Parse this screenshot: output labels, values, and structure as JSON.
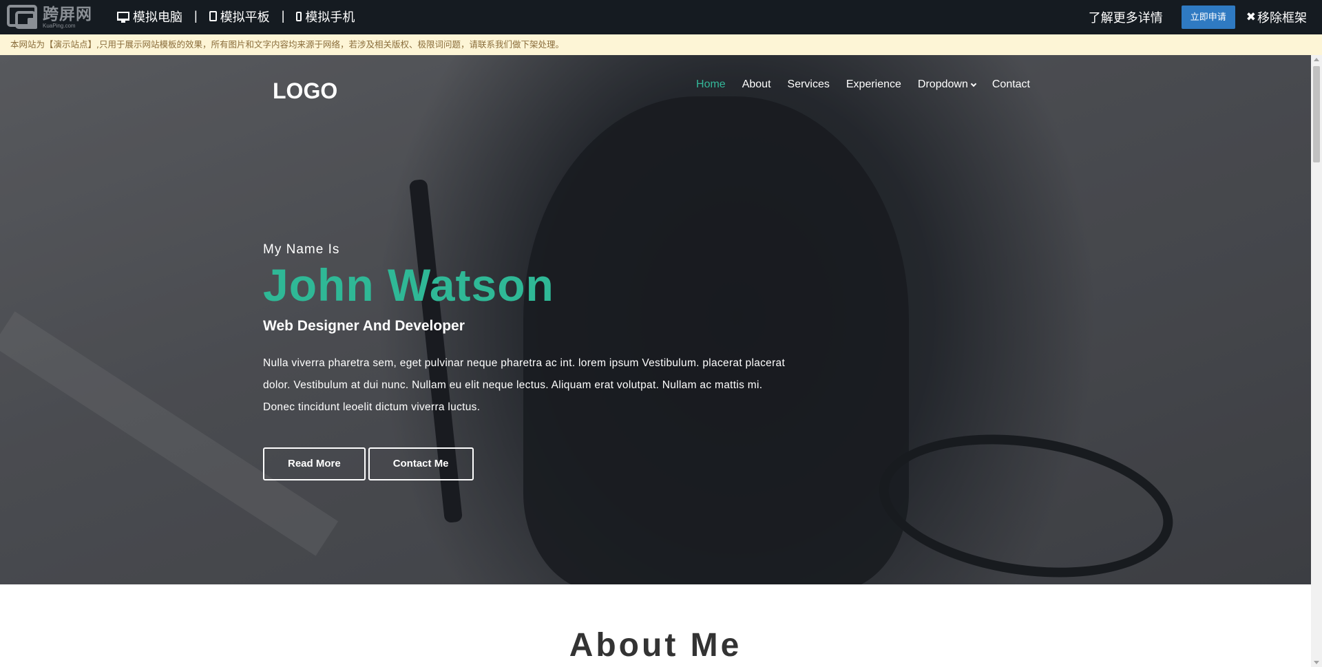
{
  "topbar": {
    "brand_cn": "跨屏网",
    "brand_en": "KuaPing.com",
    "devices": [
      "模拟电脑",
      "模拟平板",
      "模拟手机"
    ],
    "separator": "|",
    "learn_more": "了解更多详情",
    "apply": "立即申请",
    "remove_frame": "移除框架",
    "remove_icon": "✖"
  },
  "notice": "本网站为【演示站点】,只用于展示网站模板的效果，所有图片和文字内容均来源于网络，若涉及相关版权、极限词问题，请联系我们做下架处理。",
  "site": {
    "logo": "LOGO",
    "nav": [
      "Home",
      "About",
      "Services",
      "Experience",
      "Dropdown",
      "Contact"
    ],
    "active_nav": "Home"
  },
  "hero": {
    "kicker": "My Name Is",
    "name": "John Watson",
    "role": "Web Designer And Developer",
    "description": "Nulla viverra pharetra sem, eget pulvinar neque pharetra ac int. lorem ipsum Vestibulum. placerat placerat dolor. Vestibulum at dui nunc. Nullam eu elit neque lectus. Aliquam erat volutpat. Nullam ac mattis mi. Donec tincidunt leoelit dictum viverra luctus.",
    "buttons": [
      "Read More",
      "Contact Me"
    ]
  },
  "about": {
    "title": "About Me"
  },
  "colors": {
    "accent": "#2fb896",
    "topbar": "#151b21",
    "apply_button": "#2f7ac2",
    "notice_bg": "#fdf5d6"
  }
}
